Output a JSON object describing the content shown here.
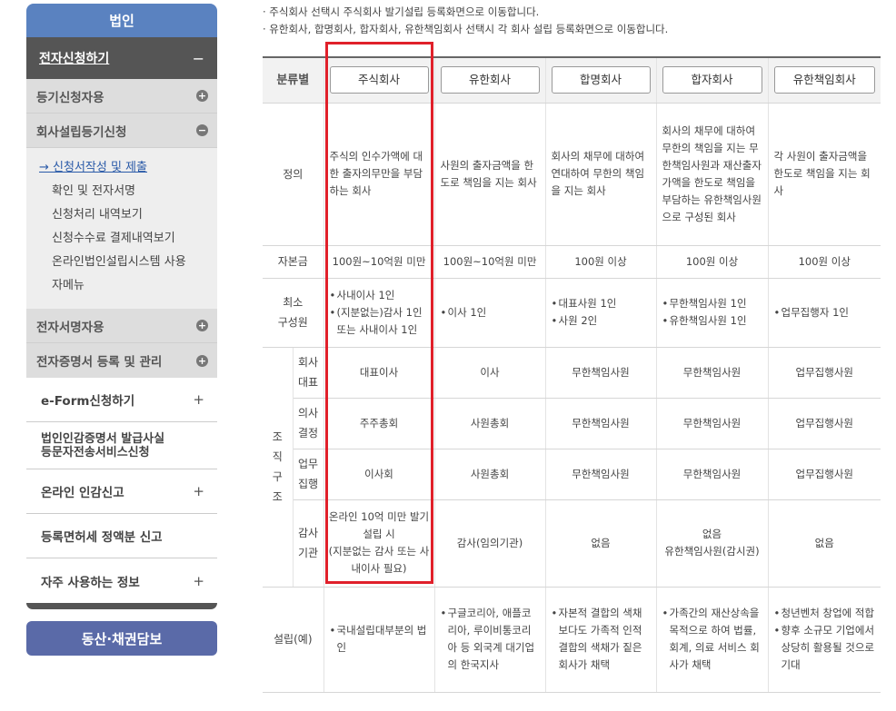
{
  "sidebar": {
    "header": "법인",
    "active_menu": {
      "label": "전자신청하기",
      "toggle": "−"
    },
    "sub_menus": [
      {
        "label": "등기신청자용",
        "toggle": "+"
      },
      {
        "label": "회사설립등기신청",
        "toggle": "−"
      }
    ],
    "sub_items": [
      "→ 신청서작성 및 제출",
      "확인 및 전자서명",
      "신청처리 내역보기",
      "신청수수료 결제내역보기",
      "온라인법인설립시스템 사용",
      "자메뉴"
    ],
    "sub_menus_2": [
      {
        "label": "전자서명자용",
        "toggle": "+"
      },
      {
        "label": "전자증명서 등록 및 관리",
        "toggle": "+"
      }
    ],
    "items": [
      {
        "label": "e-Form신청하기",
        "toggle": "+"
      },
      {
        "line1": "법인인감증명서 발급사실",
        "line2": "등문자전송서비스신청"
      },
      {
        "label": "온라인 인감신고",
        "toggle": "+"
      },
      {
        "label": "등록면허세 정액분 신고"
      },
      {
        "label": "자주 사용하는 정보",
        "toggle": "+"
      }
    ],
    "bottom_button": "동산·채권담보"
  },
  "notes": [
    "· 주식회사 선택시 주식회사 발기설립 등록화면으로 이동합니다.",
    "· 유한회사, 합명회사, 합자회사, 유한책임회사 선택시 각 회사 설립 등록화면으로 이동합니다."
  ],
  "table": {
    "header_label": "분류별",
    "companies": [
      "주식회사",
      "유한회사",
      "합명회사",
      "합자회사",
      "유한책임회사"
    ],
    "definition_label": "정의",
    "definitions": [
      "주식의 인수가액에 대한 출자의무만을 부담하는 회사",
      "사원의 출자금액을 한도로 책임을 지는 회사",
      "회사의 채무에 대하여 연대하여 무한의 책임을 지는 회사",
      "회사의 채무에 대하여 무한의 책임을 지는 무한책임사원과 재산출자 가액을 한도로 책임을 부담하는 유한책임사원으로 구성된 회사",
      "각 사원이 출자금액을 한도로 책임을 지는 회사"
    ],
    "capital_label": "자본금",
    "capital": [
      "100원~10억원 미만",
      "100원~10억원 미만",
      "100원 이상",
      "100원 이상",
      "100원 이상"
    ],
    "min_label_1": "최소",
    "min_label_2": "구성원",
    "min_members": [
      [
        "사내이사 1인",
        "(지분없는)감사 1인 또는 사내이사 1인"
      ],
      [
        "이사 1인"
      ],
      [
        "대표사원 1인",
        "사원 2인"
      ],
      [
        "무한책임사원 1인",
        "유한책임사원 1인"
      ],
      [
        "업무집행자 1인"
      ]
    ],
    "org_label": "조\n직\n구\n조",
    "org_rows": [
      {
        "l1": "회사",
        "l2": "대표",
        "values": [
          "대표이사",
          "이사",
          "무한책임사원",
          "무한책임사원",
          "업무집행사원"
        ]
      },
      {
        "l1": "의사",
        "l2": "결정",
        "values": [
          "주주총회",
          "사원총회",
          "무한책임사원",
          "무한책임사원",
          "업무집행사원"
        ]
      },
      {
        "l1": "업무",
        "l2": "집행",
        "values": [
          "이사회",
          "사원총회",
          "무한책임사원",
          "무한책임사원",
          "업무집행사원"
        ]
      },
      {
        "l1": "감사",
        "l2": "기관",
        "values": [
          "온라인 10억 미만 발기설립 시\n(지분없는 감사 또는 사내이사 필요)",
          "감사(임의기관)",
          "없음",
          "없음\n유한책임사원(감시권)",
          "없음"
        ]
      }
    ],
    "example_label": "설립(예)",
    "examples": [
      "국내설립대부분의 법인",
      "구글코리아, 애플코리아, 루이비통코리아 등 외국계 대기업의 한국지사",
      "자본적 결합의 색채보다도 가족적 인적결합의 색채가 짙은 회사가 채택",
      "가족간의 재산상속을 목적으로 하여 법률, 회계, 의료 서비스 회사가 채택",
      [
        "청년벤처 창업에 적합",
        "향후 소규모 기업에서 상당히 활용될 것으로 기대"
      ]
    ]
  },
  "colors": {
    "sidebar_header": "#5a82c0",
    "sidebar_active": "#555555",
    "highlight": "#e0202a",
    "bottom_button": "#5a6aa8"
  }
}
